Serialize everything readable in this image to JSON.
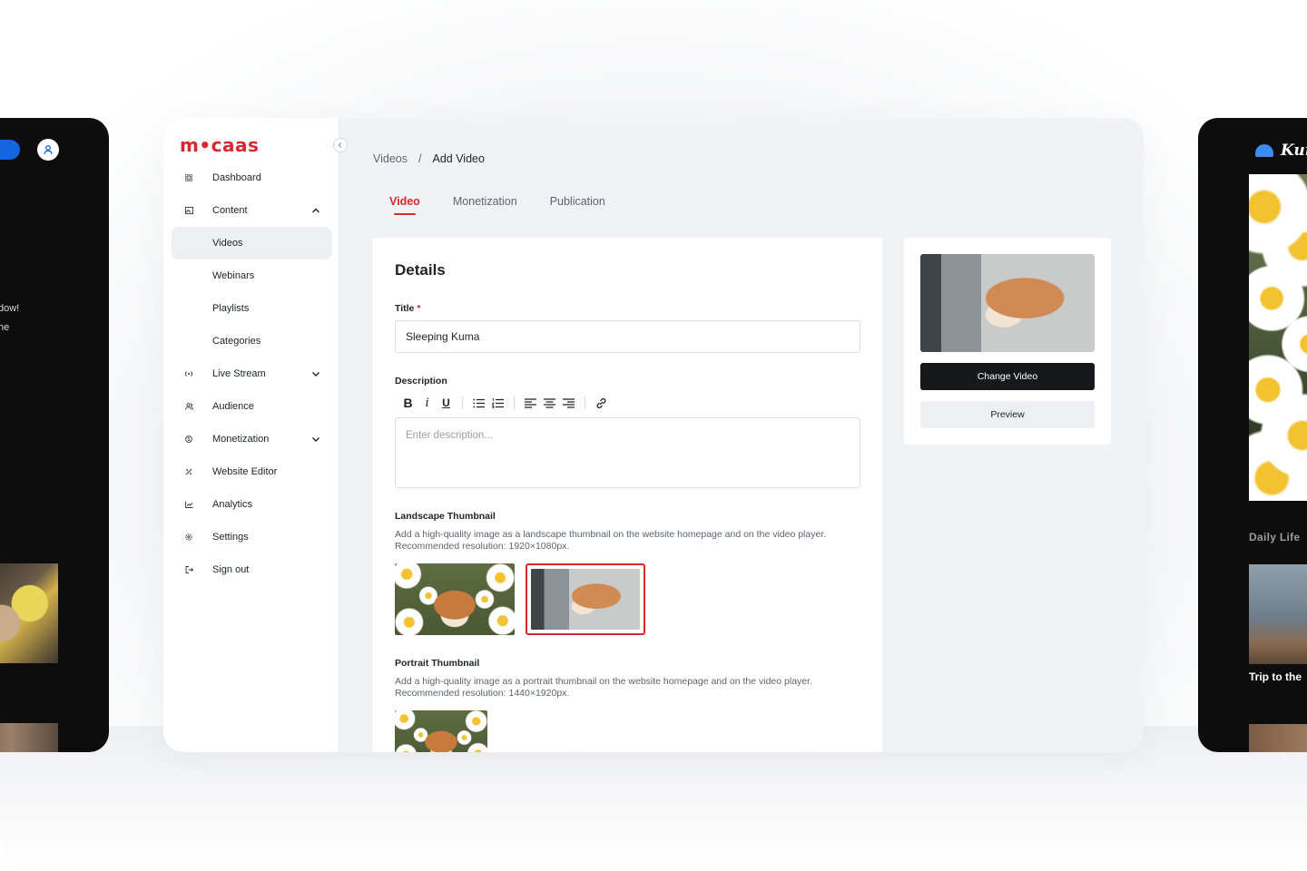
{
  "app": {
    "brand": "m•caas"
  },
  "sidebar": {
    "items": [
      {
        "label": "Dashboard",
        "icon": "grid-icon"
      },
      {
        "label": "Content",
        "icon": "image-icon",
        "expanded": true
      },
      {
        "label": "Videos",
        "sub": true,
        "active": true
      },
      {
        "label": "Webinars",
        "sub": true
      },
      {
        "label": "Playlists",
        "sub": true
      },
      {
        "label": "Categories",
        "sub": true
      },
      {
        "label": "Live Stream",
        "icon": "broadcast-icon",
        "expanded": false
      },
      {
        "label": "Audience",
        "icon": "users-icon"
      },
      {
        "label": "Monetization",
        "icon": "dollar-icon",
        "expanded": false
      },
      {
        "label": "Website Editor",
        "icon": "tools-icon"
      },
      {
        "label": "Analytics",
        "icon": "chart-icon"
      },
      {
        "label": "Settings",
        "icon": "gear-icon"
      },
      {
        "label": "Sign out",
        "icon": "signout-icon"
      }
    ]
  },
  "breadcrumb": {
    "parent": "Videos",
    "separator": "/",
    "current": "Add Video"
  },
  "tabs": [
    {
      "label": "Video",
      "active": true
    },
    {
      "label": "Monetization"
    },
    {
      "label": "Publication"
    }
  ],
  "details": {
    "heading": "Details",
    "title_label": "Title",
    "required_mark": "*",
    "title_value": "Sleeping Kuma",
    "description_label": "Description",
    "description_placeholder": "Enter description...",
    "toolbar": {
      "bold": "B",
      "italic": "i",
      "underline": "U"
    },
    "landscape": {
      "label": "Landscape Thumbnail",
      "help_line1": "Add a high-quality image as a landscape thumbnail on the website homepage and on the video player.",
      "help_line2": "Recommended resolution: 1920×1080px."
    },
    "portrait": {
      "label": "Portrait Thumbnail",
      "help_line1": "Add a high-quality image as a portrait thumbnail on the website homepage and on the video player.",
      "help_line2": "Recommended resolution: 1440×1920px."
    }
  },
  "video_card": {
    "change_label": "Change Video",
    "preview_label": "Preview"
  },
  "left_device": {
    "text_line1": "dow!",
    "text_line2": "he"
  },
  "right_device": {
    "brand": "Kun",
    "section": "Daily Life",
    "caption": "Trip to the"
  },
  "colors": {
    "accent": "#d7282f",
    "dark_button": "#16181b",
    "background": "#f1f2f6"
  }
}
